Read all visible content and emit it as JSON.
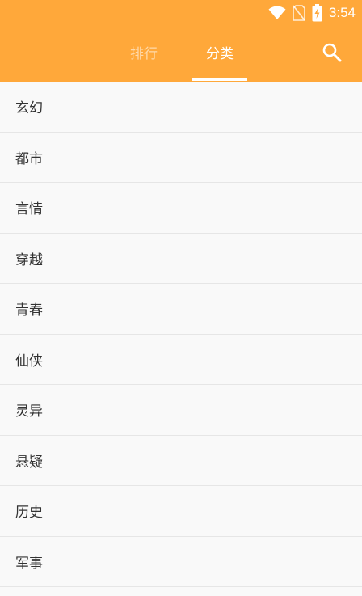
{
  "status_bar": {
    "time": "3:54",
    "icons": [
      "wifi-icon",
      "no-sim-icon",
      "battery-charging-icon"
    ]
  },
  "header": {
    "tabs": [
      {
        "label": "排行",
        "active": false
      },
      {
        "label": "分类",
        "active": true
      }
    ],
    "search_icon": "search-icon",
    "accent_color": "#ffa83a"
  },
  "categories": [
    {
      "label": "玄幻"
    },
    {
      "label": "都市"
    },
    {
      "label": "言情"
    },
    {
      "label": "穿越"
    },
    {
      "label": "青春"
    },
    {
      "label": "仙侠"
    },
    {
      "label": "灵异"
    },
    {
      "label": "悬疑"
    },
    {
      "label": "历史"
    },
    {
      "label": "军事"
    }
  ]
}
